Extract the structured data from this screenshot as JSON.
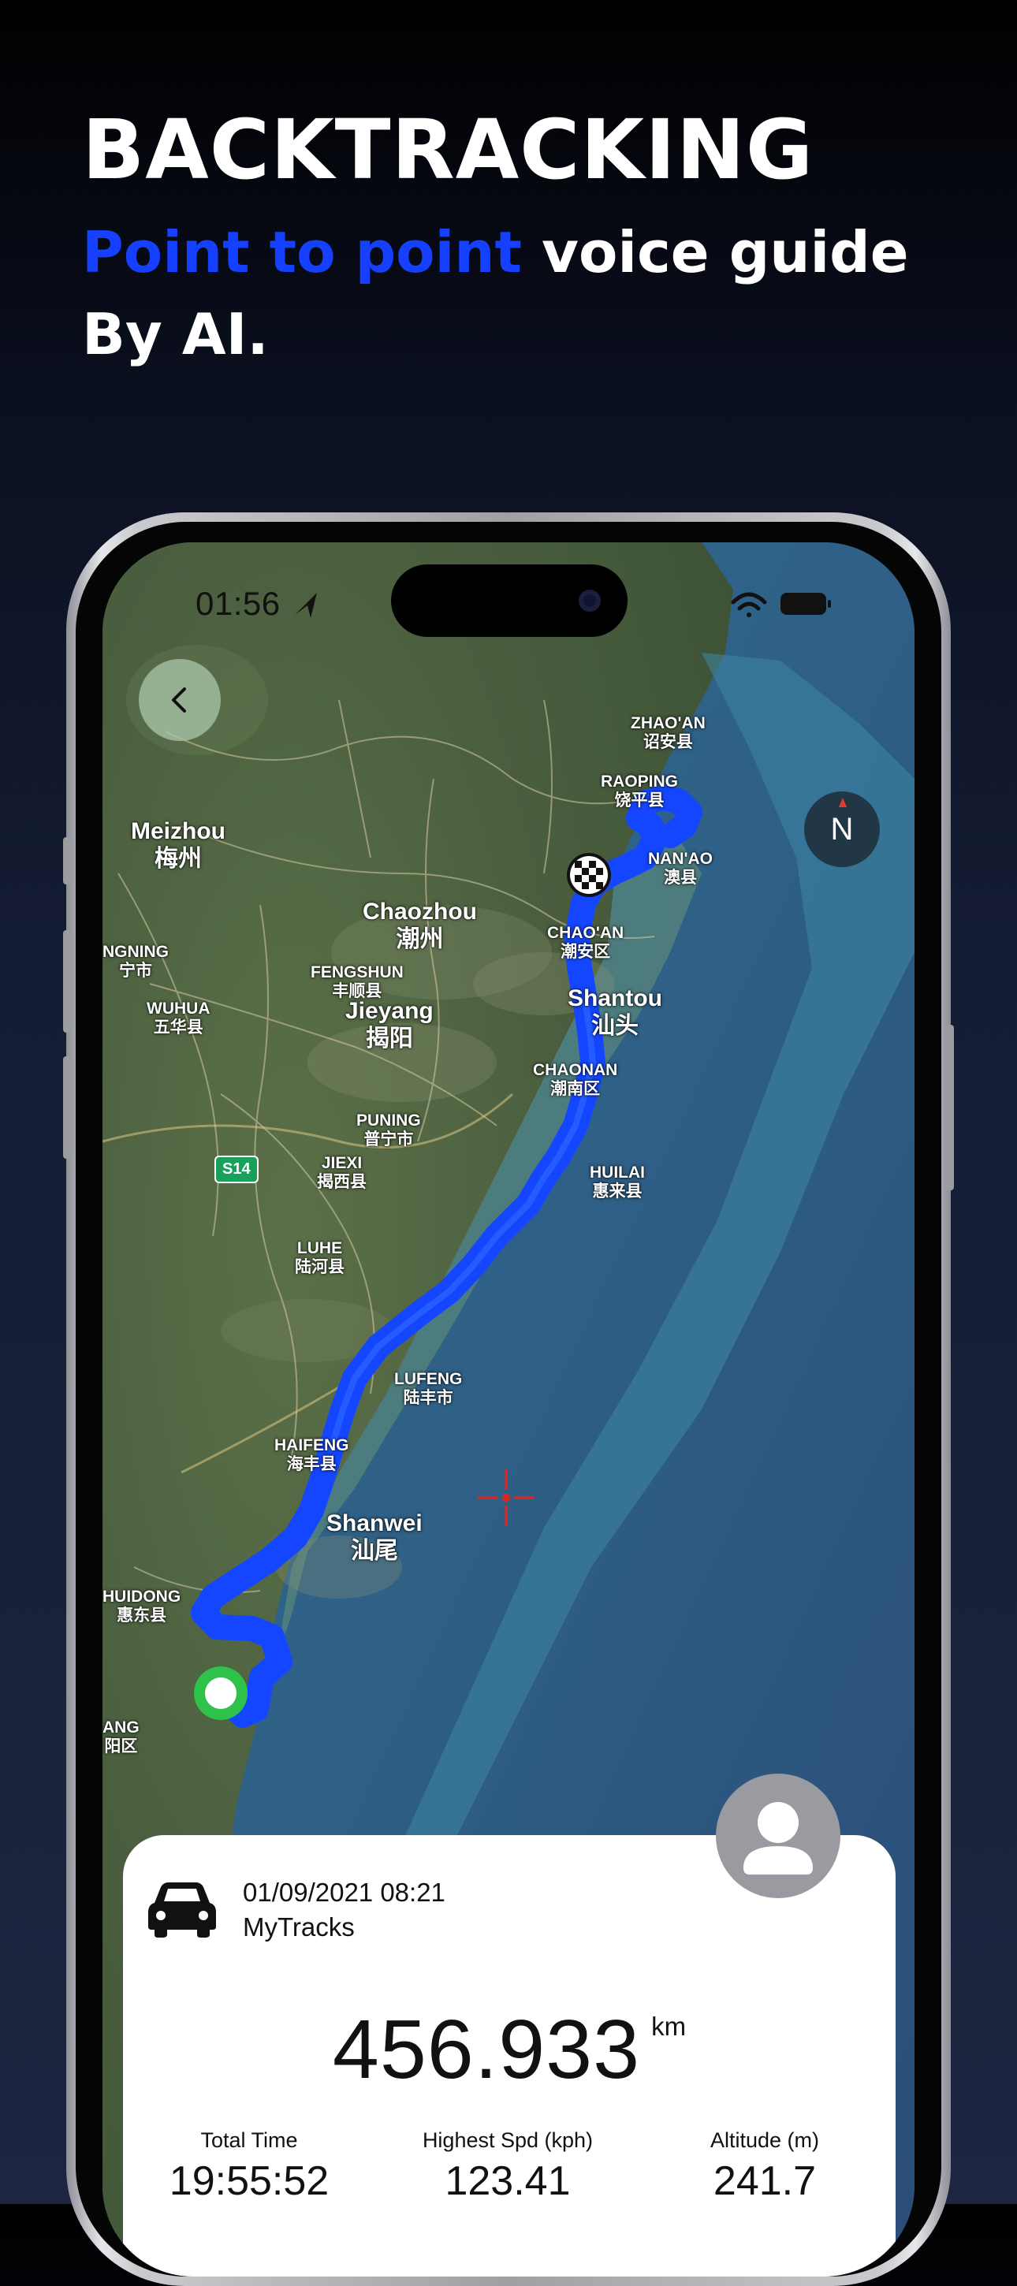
{
  "hero": {
    "title": "BACKTRACKING",
    "subtitle_accent": "Point to point",
    "subtitle_rest": " voice guide",
    "subtitle_line2": "By AI.",
    "accent_color": "#1540ff"
  },
  "status_bar": {
    "time": "01:56"
  },
  "map": {
    "compass_label": "N",
    "route_color": "#1546ff",
    "road_shield": "S14",
    "places": [
      {
        "en": "Meizhou",
        "zh": "梅州",
        "size": "big"
      },
      {
        "en": "Chaozhou",
        "zh": "潮州",
        "size": "big"
      },
      {
        "en": "Jieyang",
        "zh": "揭阳",
        "size": "big"
      },
      {
        "en": "Shantou",
        "zh": "汕头",
        "size": "big"
      },
      {
        "en": "Shanwei",
        "zh": "汕尾",
        "size": "big"
      },
      {
        "en": "ZHAO'AN",
        "zh": "诏安县",
        "size": "small"
      },
      {
        "en": "RAOPING",
        "zh": "饶平县",
        "size": "small"
      },
      {
        "en": "NAN'AO",
        "zh": "澳县",
        "size": "small"
      },
      {
        "en": "CHAO'AN",
        "zh": "潮安区",
        "size": "small"
      },
      {
        "en": "FENGSHUN",
        "zh": "丰顺县",
        "size": "small"
      },
      {
        "en": "WUHUA",
        "zh": "五华县",
        "size": "small"
      },
      {
        "en": "NGNING",
        "zh": "宁市",
        "size": "small"
      },
      {
        "en": "CHAONAN",
        "zh": "潮南区",
        "size": "small"
      },
      {
        "en": "PUNING",
        "zh": "普宁市",
        "size": "small"
      },
      {
        "en": "HUILAI",
        "zh": "惠来县",
        "size": "small"
      },
      {
        "en": "JIEXI",
        "zh": "揭西县",
        "size": "small"
      },
      {
        "en": "LUHE",
        "zh": "陆河县",
        "size": "small"
      },
      {
        "en": "LUFENG",
        "zh": "陆丰市",
        "size": "small"
      },
      {
        "en": "HAIFENG",
        "zh": "海丰县",
        "size": "small"
      },
      {
        "en": "HUIDONG",
        "zh": "惠东县",
        "size": "small"
      },
      {
        "en": "ANG",
        "zh": "阳区",
        "size": "small"
      }
    ]
  },
  "trip": {
    "datetime": "01/09/2021 08:21",
    "name": "MyTracks",
    "distance": "456.933",
    "distance_unit": "km",
    "stats": [
      {
        "label": "Total Time",
        "value": "19:55:52"
      },
      {
        "label": "Highest Spd (kph)",
        "value": "123.41"
      },
      {
        "label": "Altitude (m)",
        "value": "241.7"
      }
    ]
  }
}
